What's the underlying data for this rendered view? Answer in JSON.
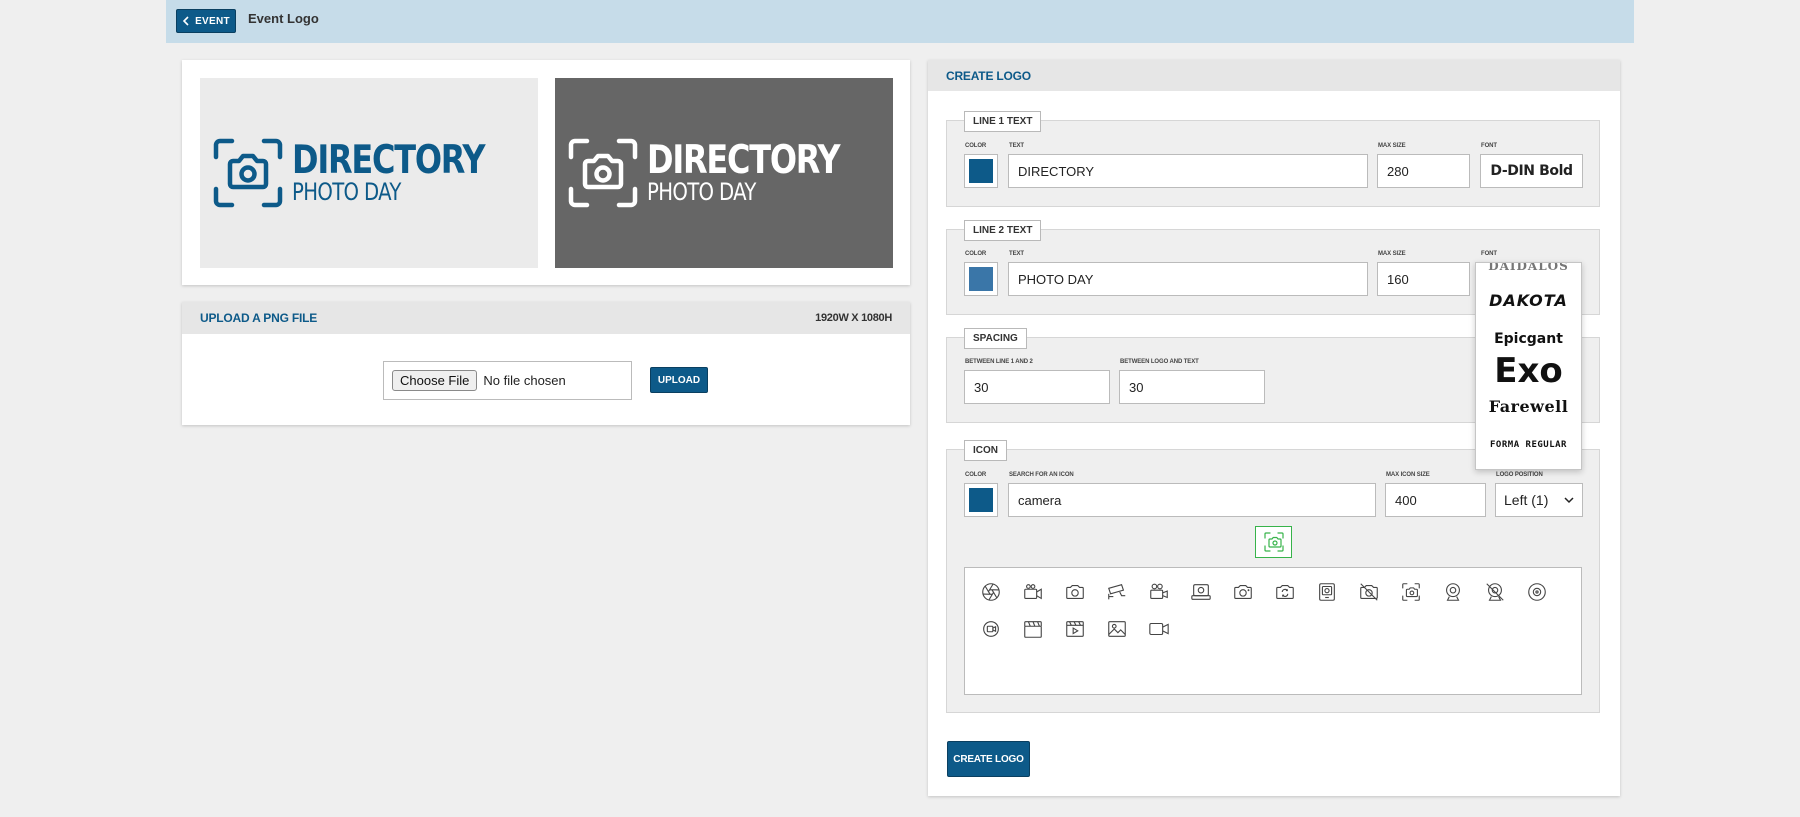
{
  "header": {
    "back_label": "EVENT",
    "title": "Event Logo"
  },
  "preview": {
    "line1": "DIRECTORY",
    "line2": "PHOTO DAY",
    "light_bg": "#ebebeb",
    "dark_bg": "#666666",
    "logo_color": "#0d5a89",
    "logo_color_dark": "#ffffff"
  },
  "upload": {
    "title": "UPLOAD A PNG FILE",
    "dimensions": "1920W X 1080H",
    "choose_label": "Choose File",
    "file_status": "No file chosen",
    "upload_label": "UPLOAD"
  },
  "create": {
    "title": "CREATE LOGO",
    "line1": {
      "legend": "LINE 1 TEXT",
      "color_label": "COLOR",
      "text_label": "TEXT",
      "size_label": "MAX SIZE",
      "font_label": "FONT",
      "color": "#0d5a89",
      "text": "DIRECTORY",
      "max_size": "280",
      "font": "D-DIN Bold"
    },
    "line2": {
      "legend": "LINE 2 TEXT",
      "color_label": "COLOR",
      "text_label": "TEXT",
      "size_label": "MAX SIZE",
      "font_label": "FONT",
      "color": "#3a76a8",
      "text": "PHOTO DAY",
      "max_size": "160"
    },
    "spacing": {
      "legend": "SPACING",
      "between_lines_label": "BETWEEN LINE 1 AND 2",
      "between_logo_label": "BETWEEN LOGO AND TEXT",
      "between_lines": "30",
      "between_logo": "30"
    },
    "icon": {
      "legend": "ICON",
      "color_label": "COLOR",
      "search_label": "SEARCH FOR AN ICON",
      "size_label": "MAX ICON SIZE",
      "position_label": "LOGO POSITION",
      "color": "#0d5a89",
      "search": "camera",
      "max_size": "400",
      "position": "Left (1)"
    },
    "font_options": [
      "DAIDALOS",
      "DAKOTA",
      "Epicgant",
      "Exo",
      "Farewell",
      "FORMA REGULAR"
    ],
    "icon_results": [
      "aperture-icon",
      "camcorder-icon",
      "camera-icon",
      "cctv-camera-icon",
      "movie-camera-icon",
      "instant-camera-icon",
      "camera-plus-icon",
      "camera-rotate-icon",
      "polaroid-icon",
      "camera-off-icon",
      "camera-focus-icon",
      "webcam-icon",
      "webcam-off-icon",
      "lens-icon",
      "record-icon",
      "clapperboard-icon",
      "video-play-icon",
      "image-icon",
      "video-camera-icon"
    ],
    "submit_label": "CREATE LOGO"
  }
}
